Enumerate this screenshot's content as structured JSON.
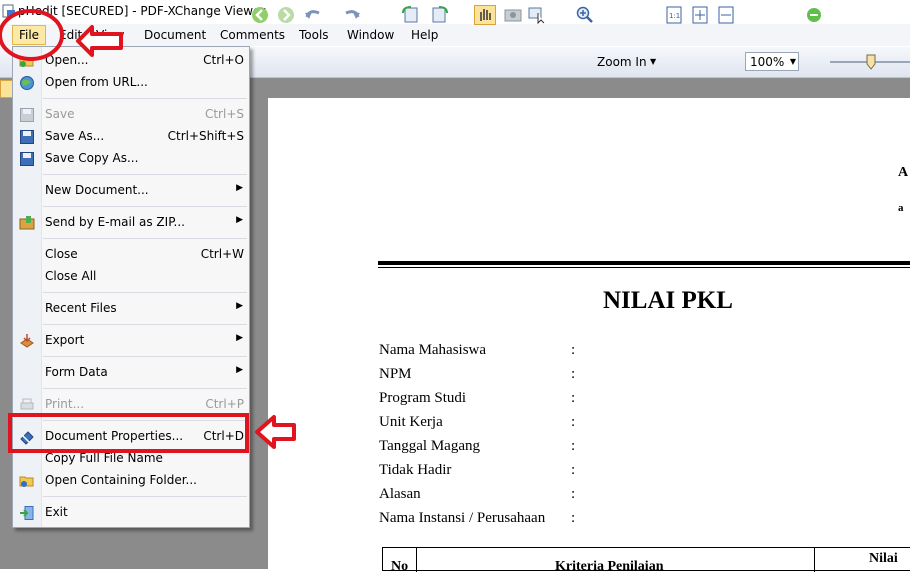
{
  "window": {
    "title": "pHedit [SECURED] - PDF-XChange Viewer"
  },
  "menubar": [
    "File",
    "Edit",
    "View",
    "Document",
    "Comments",
    "Tools",
    "Window",
    "Help"
  ],
  "toolbar": {
    "zoom_in_label": "Zoom In",
    "zoom_value": "100%"
  },
  "file_menu": {
    "open": {
      "label": "Open...",
      "shortcut": "Ctrl+O"
    },
    "open_url": {
      "label": "Open from URL..."
    },
    "save": {
      "label": "Save",
      "shortcut": "Ctrl+S"
    },
    "save_as": {
      "label": "Save As...",
      "shortcut": "Ctrl+Shift+S"
    },
    "save_copy": {
      "label": "Save Copy As..."
    },
    "new_document": {
      "label": "New Document..."
    },
    "send_email": {
      "label": "Send by E-mail as ZIP..."
    },
    "close": {
      "label": "Close",
      "shortcut": "Ctrl+W"
    },
    "close_all": {
      "label": "Close All"
    },
    "recent_files": {
      "label": "Recent Files"
    },
    "export": {
      "label": "Export"
    },
    "form_data": {
      "label": "Form Data"
    },
    "print": {
      "label": "Print...",
      "shortcut": "Ctrl+P"
    },
    "doc_properties": {
      "label": "Document Properties...",
      "shortcut": "Ctrl+D"
    },
    "copy_filename": {
      "label": "Copy Full File Name"
    },
    "open_folder": {
      "label": "Open Containing Folder..."
    },
    "exit": {
      "label": "Exit"
    }
  },
  "document": {
    "header_fragment_1": "A",
    "header_fragment_2": "a",
    "heading": "NILAI PKL",
    "fields": [
      {
        "label": "Nama Mahasiswa",
        "sep": ":"
      },
      {
        "label": "NPM",
        "sep": ":"
      },
      {
        "label": "Program Studi",
        "sep": ":"
      },
      {
        "label": "Unit Kerja",
        "sep": ":"
      },
      {
        "label": "Tanggal  Magang",
        "sep": ":"
      },
      {
        "label": "Tidak Hadir",
        "sep": ":"
      },
      {
        "label": "Alasan",
        "sep": ":"
      },
      {
        "label": "Nama Instansi / Perusahaan",
        "sep": ":"
      }
    ],
    "table_headers": [
      "No",
      "Kriteria Penilaian",
      "Nilai"
    ]
  },
  "annotation_color": "#e0141e"
}
